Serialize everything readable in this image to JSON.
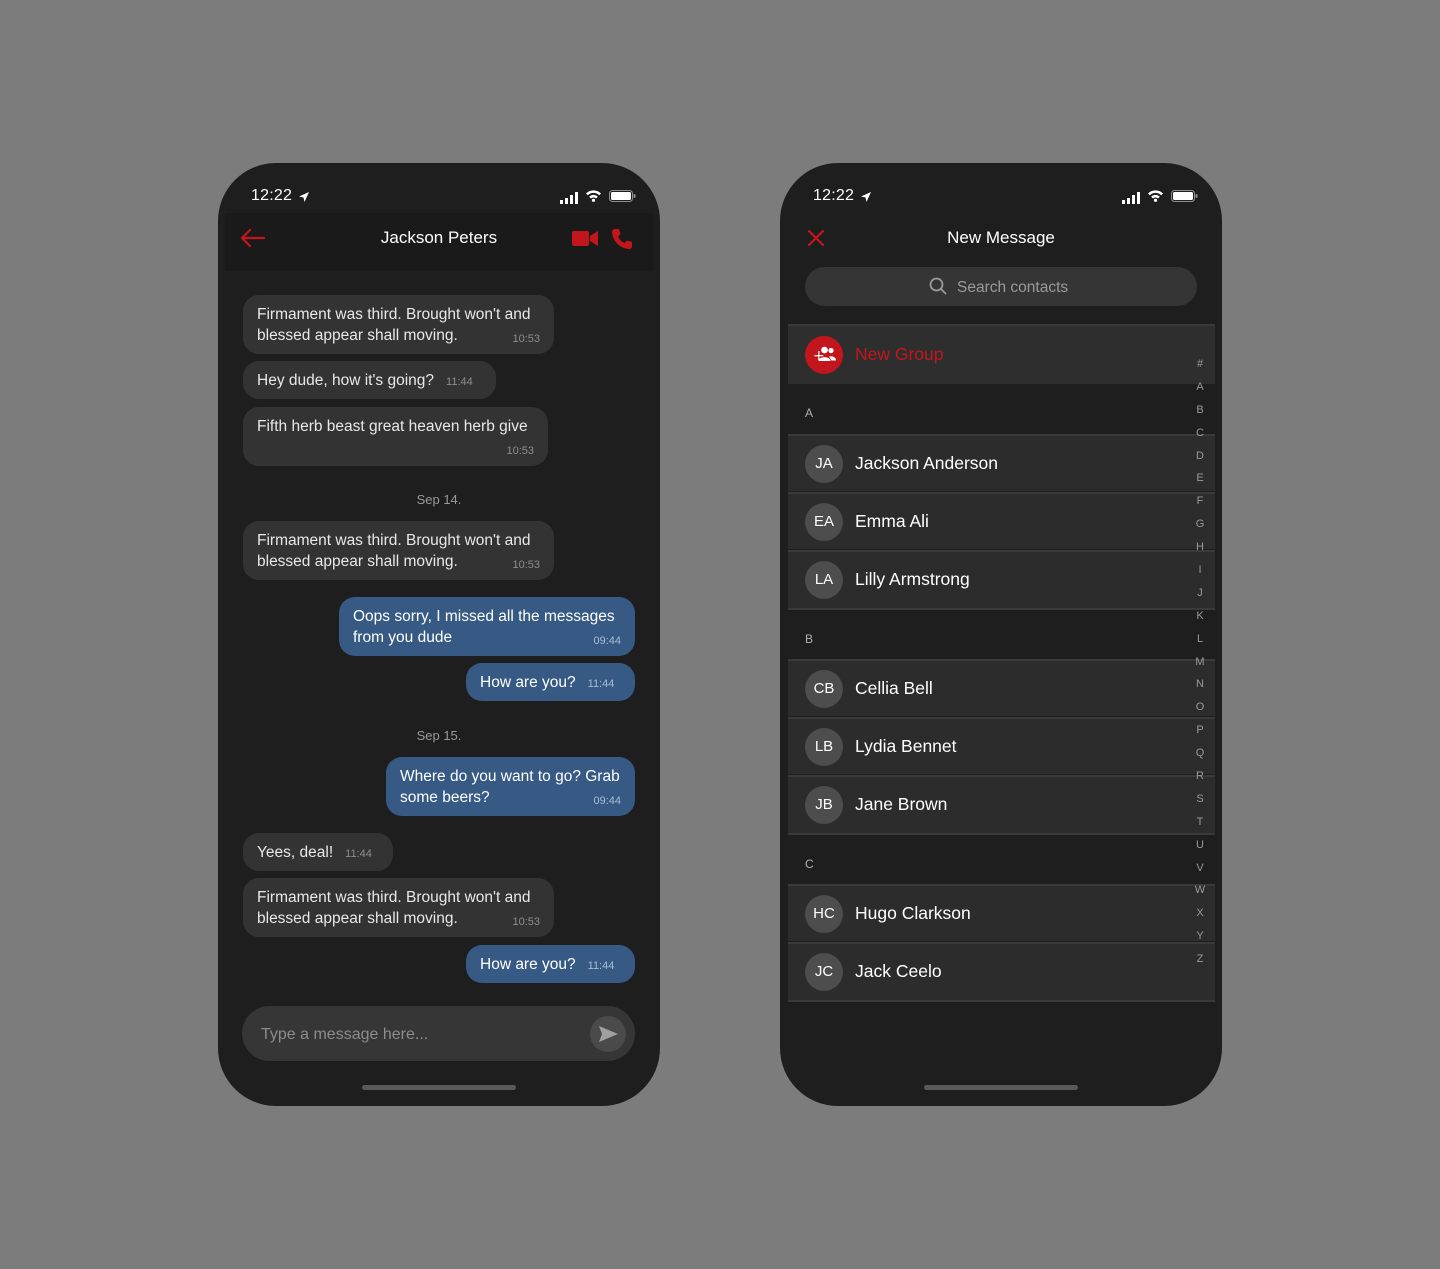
{
  "status_time": "12:22",
  "colors": {
    "accent_red": "#c3161c",
    "outgoing_bubble": "#365a84",
    "incoming_bubble": "#333334"
  },
  "chat": {
    "title": "Jackson Peters",
    "icons": {
      "back": "back-arrow-icon",
      "video": "video-camera-icon",
      "call": "phone-icon"
    },
    "messages": [
      {
        "dir": "in",
        "text": "Firmament was third. Brought won't and blessed appear shall moving.",
        "time": "10:53"
      },
      {
        "dir": "in",
        "text": "Hey dude, how it's going?",
        "time": "11:44"
      },
      {
        "dir": "in",
        "text": "Fifth herb beast great heaven herb give",
        "time": "10:53"
      },
      {
        "dir": "in",
        "text": "Firmament was third. Brought won't and blessed appear shall moving.",
        "time": "10:53"
      },
      {
        "dir": "out",
        "text": "Oops sorry, I missed all the messages from you dude",
        "time": "09:44"
      },
      {
        "dir": "out",
        "text": "How are you?",
        "time": "11:44"
      },
      {
        "dir": "out",
        "text": "Where do you want to go? Grab some beers?",
        "time": "09:44"
      },
      {
        "dir": "in",
        "text": "Yees, deal!",
        "time": "11:44"
      },
      {
        "dir": "in",
        "text": "Firmament was third. Brought won't and blessed appear shall moving.",
        "time": "10:53"
      },
      {
        "dir": "out",
        "text": "How are you?",
        "time": "11:44"
      }
    ],
    "date_separators": [
      "Sep 14.",
      "Sep 15."
    ],
    "composer_placeholder": "Type a message here..."
  },
  "new_message": {
    "title": "New Message",
    "search_placeholder": "Search contacts",
    "new_group_label": "New Group",
    "sections": [
      {
        "letter": "A",
        "contacts": [
          {
            "initials": "JA",
            "name": "Jackson Anderson"
          },
          {
            "initials": "EA",
            "name": "Emma Ali"
          },
          {
            "initials": "LA",
            "name": "Lilly Armstrong"
          }
        ]
      },
      {
        "letter": "B",
        "contacts": [
          {
            "initials": "CB",
            "name": "Cellia Bell"
          },
          {
            "initials": "LB",
            "name": "Lydia Bennet"
          },
          {
            "initials": "JB",
            "name": "Jane Brown"
          }
        ]
      },
      {
        "letter": "C",
        "contacts": [
          {
            "initials": "HC",
            "name": "Hugo Clarkson"
          },
          {
            "initials": "JC",
            "name": "Jack Ceelo"
          }
        ]
      }
    ],
    "alphabet": [
      "#",
      "A",
      "B",
      "C",
      "D",
      "E",
      "F",
      "G",
      "H",
      "I",
      "J",
      "K",
      "L",
      "M",
      "N",
      "O",
      "P",
      "Q",
      "R",
      "S",
      "T",
      "U",
      "V",
      "W",
      "X",
      "Y",
      "Z"
    ]
  }
}
